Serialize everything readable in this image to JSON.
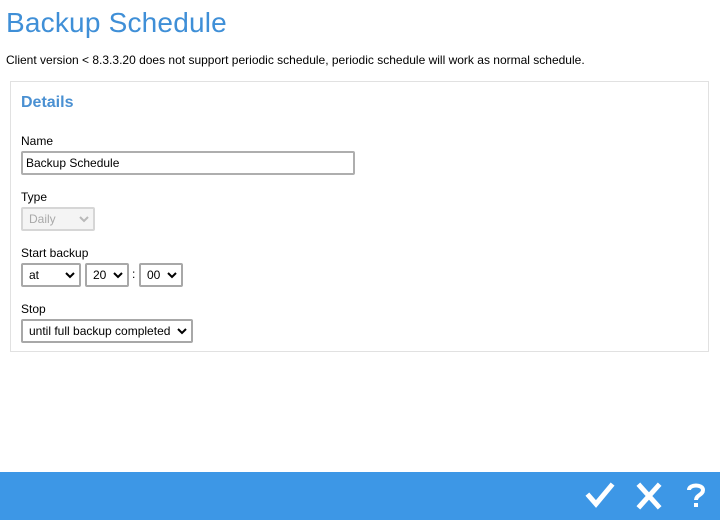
{
  "header": {
    "title": "Backup Schedule",
    "notice": "Client version < 8.3.3.20 does not support periodic schedule, periodic schedule will work as normal schedule."
  },
  "details": {
    "title": "Details",
    "name": {
      "label": "Name",
      "value": "Backup Schedule"
    },
    "type": {
      "label": "Type",
      "selected": "Daily",
      "disabled": true
    },
    "start_backup": {
      "label": "Start backup",
      "mode": "at",
      "hour": "20",
      "separator": ":",
      "minute": "00"
    },
    "stop": {
      "label": "Stop",
      "selected": "until full backup completed"
    }
  },
  "footer": {
    "background": "#3d97e6",
    "buttons": [
      {
        "icon": "check-icon"
      },
      {
        "icon": "close-icon"
      },
      {
        "icon": "help-icon"
      }
    ]
  },
  "colors": {
    "title": "#3f8fd7",
    "section_title": "#4a90d2"
  }
}
